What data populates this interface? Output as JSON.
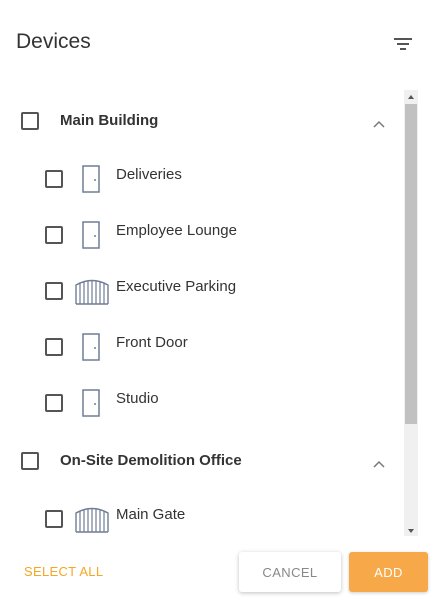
{
  "header": {
    "title": "Devices",
    "filter_icon": "filter-icon"
  },
  "groups": [
    {
      "label": "Main Building",
      "expanded": true,
      "devices": [
        {
          "label": "Deliveries",
          "icon": "door-icon"
        },
        {
          "label": "Employee Lounge",
          "icon": "door-icon"
        },
        {
          "label": "Executive Parking",
          "icon": "gate-icon"
        },
        {
          "label": "Front Door",
          "icon": "door-icon"
        },
        {
          "label": "Studio",
          "icon": "door-icon"
        }
      ]
    },
    {
      "label": "On-Site Demolition Office",
      "expanded": true,
      "devices": [
        {
          "label": "Main Gate",
          "icon": "gate-icon"
        }
      ]
    }
  ],
  "footer": {
    "select_all_label": "SELECT ALL",
    "cancel_label": "CANCEL",
    "add_label": "ADD"
  },
  "colors": {
    "accent": "#f7a94a",
    "accent_text": "#f5a623",
    "icon": "#6f7d96"
  }
}
